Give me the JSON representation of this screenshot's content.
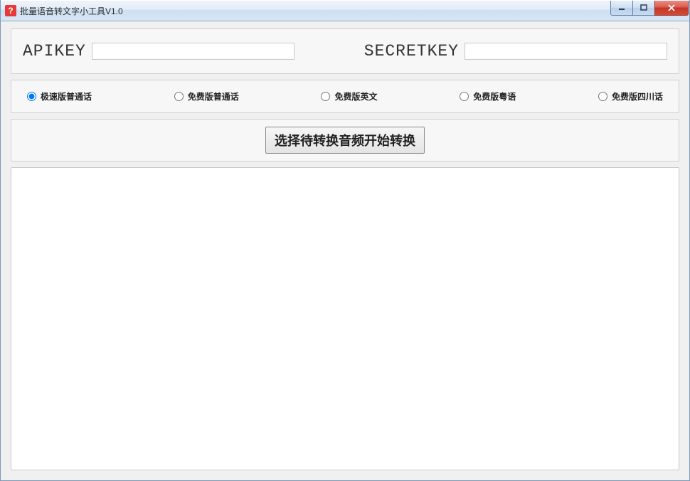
{
  "window": {
    "title": "批量语音转文字小工具V1.0"
  },
  "keys": {
    "apikey_label": "APIKEY",
    "apikey_value": "",
    "secretkey_label": "SECRETKEY",
    "secretkey_value": ""
  },
  "radio_options": {
    "selected_index": 0,
    "items": [
      {
        "label": "极速版普通话"
      },
      {
        "label": "免费版普通话"
      },
      {
        "label": "免费版英文"
      },
      {
        "label": "免费版粤语"
      },
      {
        "label": "免费版四川话"
      }
    ]
  },
  "main_button": {
    "label": "选择待转换音频开始转换"
  },
  "output": {
    "text": ""
  },
  "app_icon": {
    "glyph": "?"
  }
}
